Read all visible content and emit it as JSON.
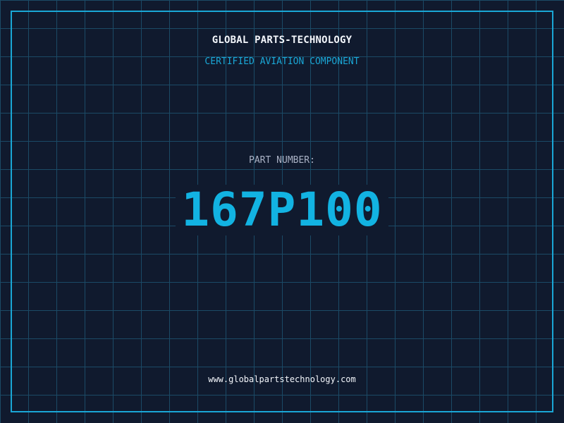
{
  "header": {
    "company_name": "GLOBAL PARTS-TECHNOLOGY",
    "subtitle": "CERTIFIED AVIATION COMPONENT"
  },
  "part": {
    "label": "PART NUMBER:",
    "number": "167P100"
  },
  "footer": {
    "website": "www.globalpartstechnology.com"
  },
  "colors": {
    "background": "#101a2e",
    "grid": "#1b4a66",
    "accent": "#1aa7d6",
    "part_number": "#12b3e2",
    "text_primary": "#f3f6fb",
    "text_muted": "#aab2c5"
  }
}
